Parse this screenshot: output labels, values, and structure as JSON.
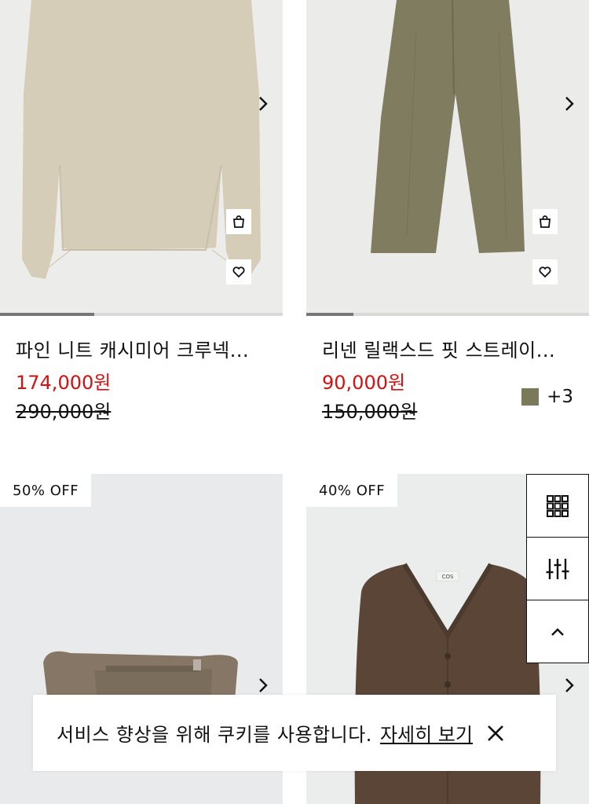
{
  "products": [
    {
      "name": "파인 니트 캐시미어 크루넥...",
      "sale_price": "174,000원",
      "original_price": "290,000원",
      "image_progress": 0.33
    },
    {
      "name": "리넨 릴랙스드 핏 스트레이...",
      "sale_price": "90,000원",
      "original_price": "150,000원",
      "image_progress": 0.17,
      "swatch_color": "#7a7a5a",
      "more_colors": "+3"
    },
    {
      "badge": "50% OFF"
    },
    {
      "badge": "40% OFF",
      "garment_label": "COS"
    }
  ],
  "icons": {
    "next": "chevron-right-icon",
    "bag": "shopping-bag-icon",
    "wishlist": "heart-icon",
    "grid": "grid-view-icon",
    "filter": "filter-sliders-icon",
    "top": "chevron-up-icon",
    "close": "close-icon"
  },
  "cookie_banner": {
    "text": "서비스 향상을 위해 쿠키를 사용합니다.",
    "link": "자세히 보기"
  },
  "colors": {
    "sale": "#d70f0f",
    "text": "#111111"
  }
}
